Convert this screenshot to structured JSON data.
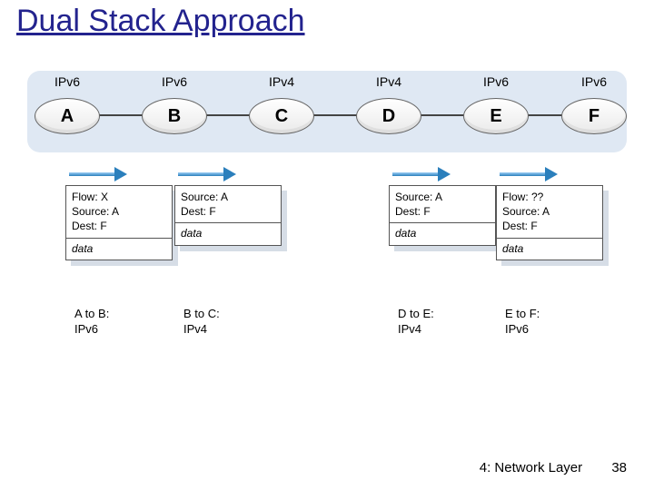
{
  "title": "Dual Stack Approach",
  "nodes": [
    {
      "letter": "A",
      "proto": "IPv6"
    },
    {
      "letter": "B",
      "proto": "IPv6"
    },
    {
      "letter": "C",
      "proto": "IPv4"
    },
    {
      "letter": "D",
      "proto": "IPv4"
    },
    {
      "letter": "E",
      "proto": "IPv6"
    },
    {
      "letter": "F",
      "proto": "IPv6"
    }
  ],
  "packets": [
    {
      "lines": [
        "Flow: X",
        "Source: A",
        "Dest: F"
      ],
      "data": "data"
    },
    {
      "lines": [
        "Source: A",
        "Dest: F"
      ],
      "data": "data"
    },
    {
      "lines": [
        "Source: A",
        "Dest: F"
      ],
      "data": "data"
    },
    {
      "lines": [
        "Flow: ??",
        "Source: A",
        "Dest: F"
      ],
      "data": "data"
    }
  ],
  "hops": [
    {
      "l1": "A to B:",
      "l2": "IPv6"
    },
    {
      "l1": "B to C:",
      "l2": "IPv4"
    },
    {
      "l1": "D to E:",
      "l2": "IPv4"
    },
    {
      "l1": "E to F:",
      "l2": "IPv6"
    }
  ],
  "footer": {
    "chapter": "4: Network Layer",
    "page": "38"
  }
}
